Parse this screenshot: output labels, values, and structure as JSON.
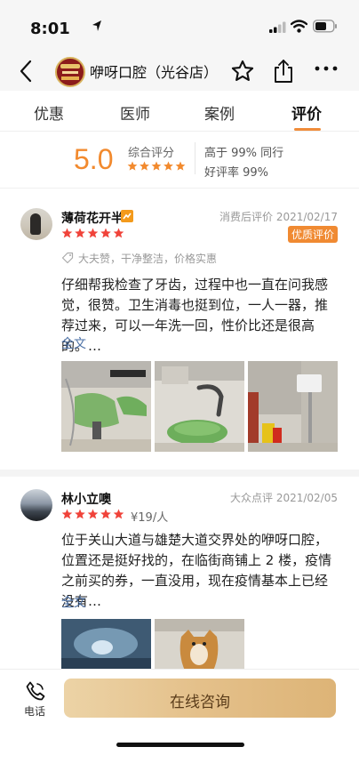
{
  "status_bar": {
    "time": "8:01"
  },
  "header": {
    "shop_name": "咿呀口腔（光谷店）"
  },
  "tabs": [
    {
      "label": "优惠"
    },
    {
      "label": "医师"
    },
    {
      "label": "案例"
    },
    {
      "label": "评价"
    }
  ],
  "active_tab": "评价",
  "summary": {
    "score": "5.0",
    "score_label": "综合评分",
    "rating_stars": 5,
    "stat_peer": "高于 99% 同行",
    "stat_good": "好评率 99%"
  },
  "reviews": [
    {
      "user": "薄荷花开半",
      "meta": "消费后评价  2021/02/17",
      "stars": 5,
      "tag": "优质评价",
      "tags_text": "大夫赞，干净整洁，价格实惠",
      "text": "仔细帮我检查了牙齿，过程中也一直在问我感觉，很赞。卫生消毒也挺到位，一人一器，推荐过来，可以一年洗一回，性价比还是很高的。…",
      "read_more": "全文"
    },
    {
      "user": "林小立噢",
      "meta": "大众点评  2021/02/05",
      "stars": 5,
      "price": "¥19/人",
      "text": "位于关山大道与雄楚大道交界处的咿呀口腔，位置还是挺好找的，在临街商铺上 2 楼，疫情之前买的券，一直没用，现在疫情基本上已经没有…",
      "read_more": "全文"
    }
  ],
  "bottom": {
    "phone_label": "电话",
    "consult_label": "在线咨询"
  },
  "colors": {
    "accent": "#f28a2e",
    "star_red": "#f0433a",
    "link_blue": "#4a6fa5",
    "consult_gold": "#e4c08a"
  }
}
